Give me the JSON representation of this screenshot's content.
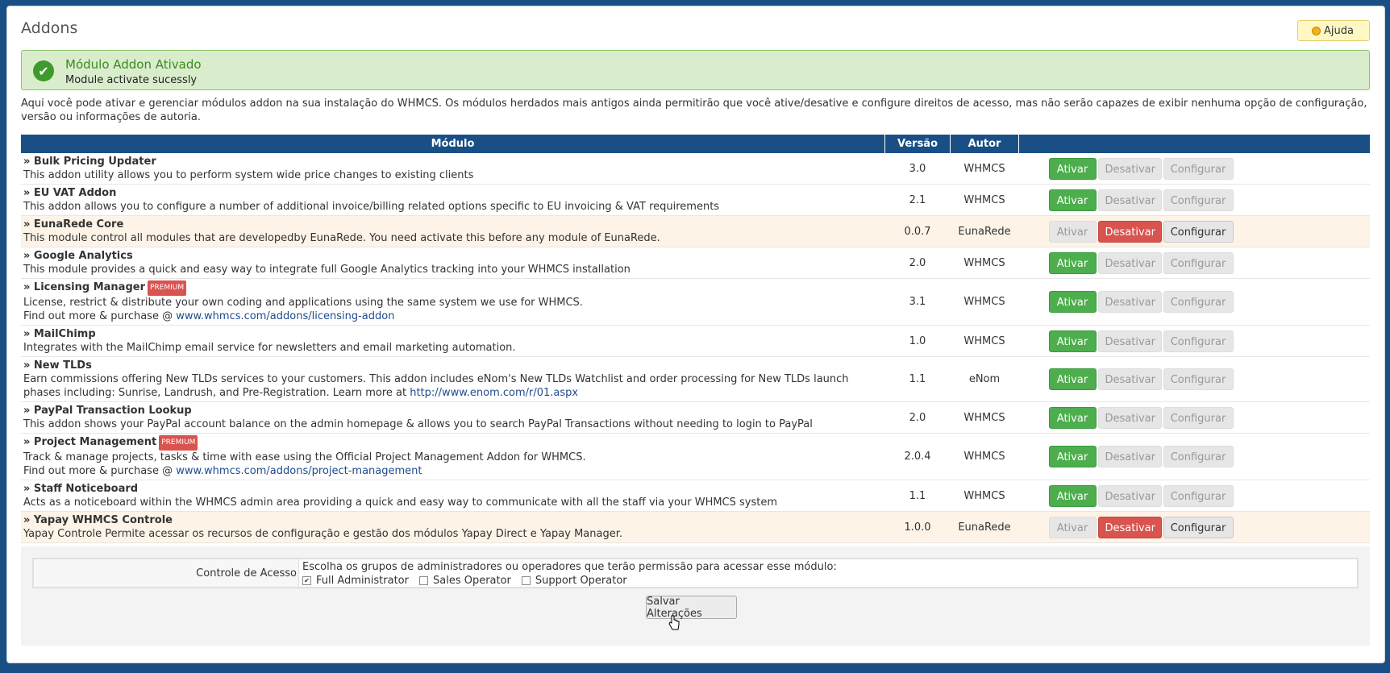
{
  "page": {
    "title": "Addons",
    "help_label": "Ajuda"
  },
  "alert": {
    "title": "Módulo Addon Ativado",
    "message": "Module activate sucessly"
  },
  "intro": "Aqui você pode ativar e gerenciar módulos addon na sua instalação do WHMCS. Os módulos herdados mais antigos ainda permitirão que você ative/desative e configure direitos de acesso, mas não serão capazes de exibir nenhuma opção de configuração, versão ou informações de autoria.",
  "table": {
    "headers": {
      "module": "Módulo",
      "version": "Versão",
      "author": "Autor",
      "actions": ""
    },
    "buttons": {
      "activate": "Ativar",
      "deactivate": "Desativar",
      "configure": "Configurar"
    },
    "premium_label": "PREMIUM",
    "rows": [
      {
        "name": "» Bulk Pricing Updater",
        "desc": "This addon utility allows you to perform system wide price changes to existing clients",
        "version": "3.0",
        "author": "WHMCS"
      },
      {
        "name": "» EU VAT Addon",
        "desc": "This addon allows you to configure a number of additional invoice/billing related options specific to EU invoicing & VAT requirements",
        "version": "2.1",
        "author": "WHMCS"
      },
      {
        "name": "» EunaRede Core",
        "desc": "This module control all modules that are developedby EunaRede. You need activate this before any module of EunaRede.",
        "version": "0.0.7",
        "author": "EunaRede"
      },
      {
        "name": "» Google Analytics",
        "desc": "This module provides a quick and easy way to integrate full Google Analytics tracking into your WHMCS installation",
        "version": "2.0",
        "author": "WHMCS"
      },
      {
        "name": "» Licensing Manager",
        "desc": "License, restrict & distribute your own coding and applications using the same system we use for WHMCS.",
        "desc2": "Find out more & purchase @ ",
        "link": "www.whmcs.com/addons/licensing-addon",
        "version": "3.1",
        "author": "WHMCS"
      },
      {
        "name": "» MailChimp",
        "desc": "Integrates with the MailChimp email service for newsletters and email marketing automation.",
        "version": "1.0",
        "author": "WHMCS"
      },
      {
        "name": "» New TLDs",
        "desc": "Earn commissions offering New TLDs services to your customers. This addon includes eNom's New TLDs Watchlist and order processing for New TLDs launch phases including: Sunrise, Landrush, and Pre-Registration. Learn more at ",
        "link": "http://www.enom.com/r/01.aspx",
        "version": "1.1",
        "author": "eNom"
      },
      {
        "name": "» PayPal Transaction Lookup",
        "desc": "This addon shows your PayPal account balance on the admin homepage & allows you to search PayPal Transactions without needing to login to PayPal",
        "version": "2.0",
        "author": "WHMCS"
      },
      {
        "name": "» Project Management",
        "desc": "Track & manage projects, tasks & time with ease using the Official Project Management Addon for WHMCS.",
        "desc2": "Find out more & purchase @ ",
        "link": "www.whmcs.com/addons/project-management",
        "version": "2.0.4",
        "author": "WHMCS"
      },
      {
        "name": "» Staff Noticeboard",
        "desc": "Acts as a noticeboard within the WHMCS admin area providing a quick and easy way to communicate with all the staff via your WHMCS system",
        "version": "1.1",
        "author": "WHMCS"
      },
      {
        "name": "» Yapay WHMCS Controle",
        "desc": "Yapay Controle Permite acessar os recursos de configuração e gestão dos módulos Yapay Direct e Yapay Manager.",
        "version": "1.0.0",
        "author": "EunaRede"
      }
    ]
  },
  "access": {
    "label": "Controle de Acesso",
    "text": "Escolha os grupos de administradores ou operadores que terão permissão para acessar esse módulo:",
    "options": [
      {
        "label": "Full Administrator",
        "checked": true
      },
      {
        "label": "Sales Operator",
        "checked": false
      },
      {
        "label": "Support Operator",
        "checked": false
      }
    ]
  },
  "save_label": "Salvar Alterações"
}
